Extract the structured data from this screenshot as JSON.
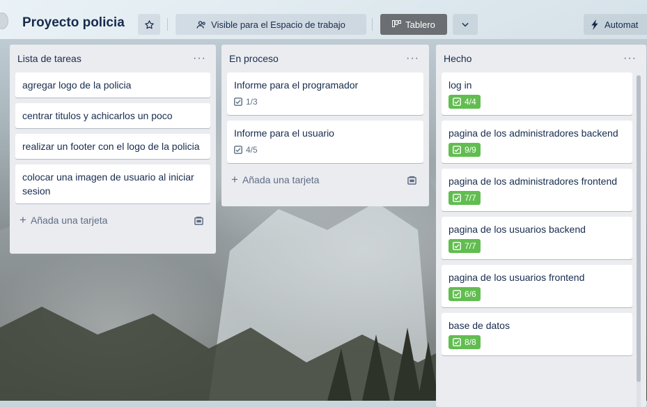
{
  "board": {
    "title": "Proyecto policia",
    "visibility_label": "Visible para el Espacio de trabajo",
    "view_label": "Tablero",
    "automation_label": "Automat"
  },
  "icons": {
    "star": "star-icon",
    "visibility": "people-icon",
    "view": "board-icon",
    "dropdown": "chevron-down-icon",
    "automation": "lightning-icon",
    "checklist": "checkbox-icon",
    "template": "card-template-icon",
    "add": "plus-icon",
    "menu": "ellipsis-icon"
  },
  "colors": {
    "complete_badge": "#61bd4f",
    "list_bg": "#ebecf0",
    "text": "#172b4d",
    "view_button": "#6b6f73"
  },
  "lists": [
    {
      "title": "Lista de tareas",
      "add_label": "Añada una tarjeta",
      "cards": [
        {
          "title": "agregar logo de la policia"
        },
        {
          "title": "centrar titulos y achicarlos un poco"
        },
        {
          "title": "realizar un footer con el logo de la policia"
        },
        {
          "title": "colocar una imagen de usuario al iniciar sesion"
        }
      ]
    },
    {
      "title": "En proceso",
      "add_label": "Añada una tarjeta",
      "cards": [
        {
          "title": "Informe para el programador",
          "checklist": "1/3"
        },
        {
          "title": "Informe para el usuario",
          "checklist": "4/5"
        }
      ]
    },
    {
      "title": "Hecho",
      "cards": [
        {
          "title": "log in",
          "checklist": "4/4"
        },
        {
          "title": "pagina de los administradores backend",
          "checklist": "9/9"
        },
        {
          "title": "pagina de los administradores frontend",
          "checklist": "7/7"
        },
        {
          "title": "pagina de los usuarios backend",
          "checklist": "7/7"
        },
        {
          "title": "pagina de los usuarios frontend",
          "checklist": "6/6"
        },
        {
          "title": "base de datos",
          "checklist": "8/8"
        }
      ]
    }
  ]
}
